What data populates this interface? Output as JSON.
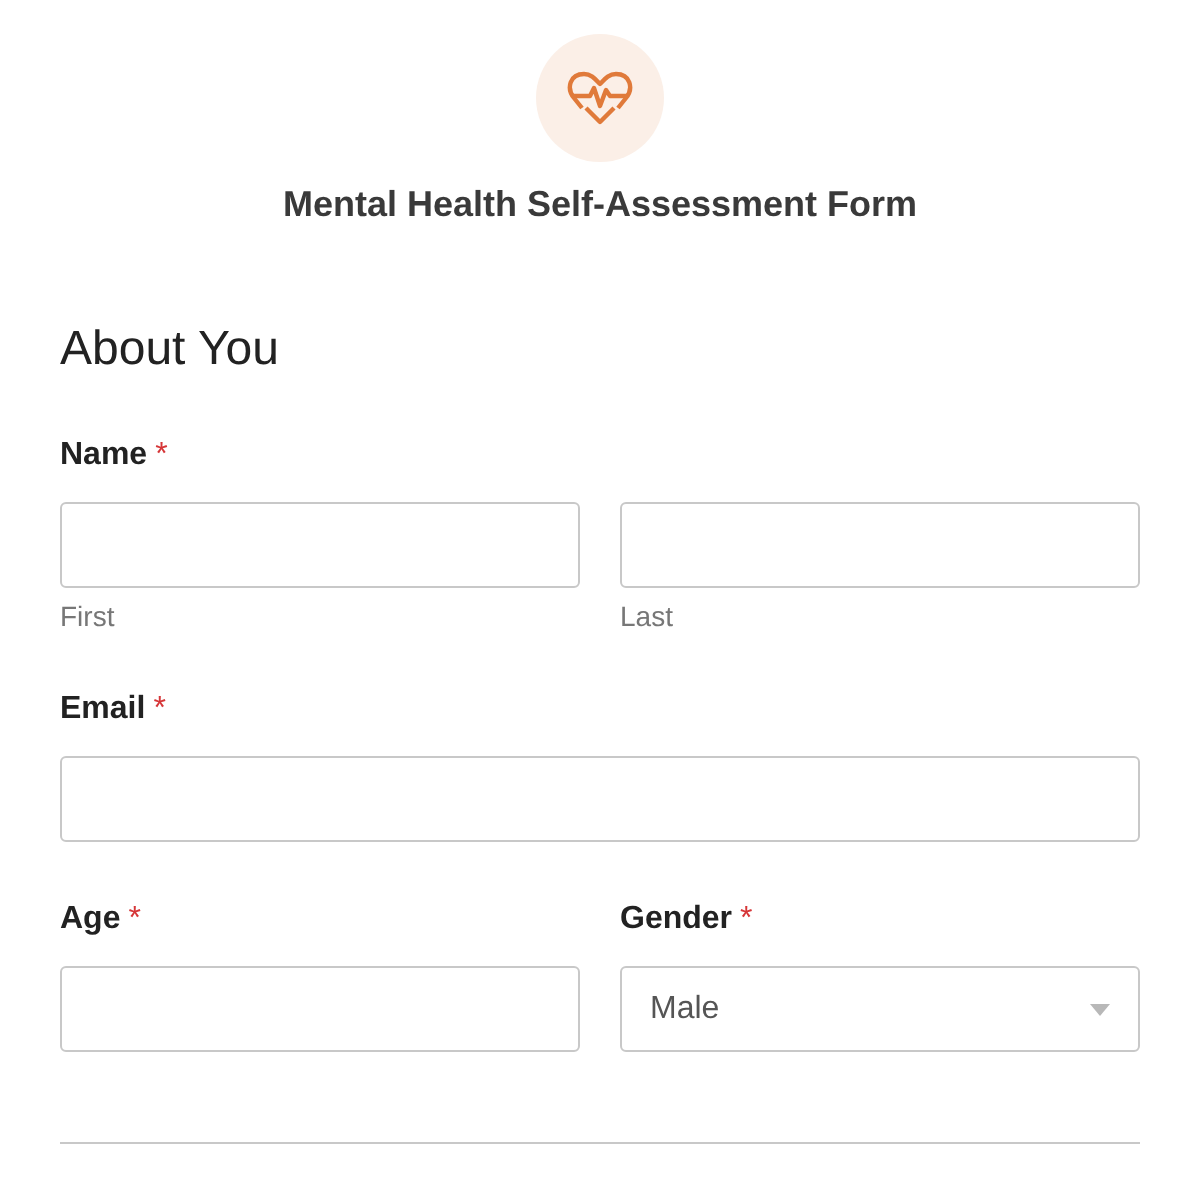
{
  "form": {
    "title": "Mental Health Self-Assessment Form"
  },
  "section": {
    "title": "About You"
  },
  "rows": [
    {
      "groups": [
        {
          "label": "Name",
          "required_mark": "*",
          "inputs": [
            {
              "kind": "text",
              "sublabel": "First"
            },
            {
              "kind": "text",
              "sublabel": "Last"
            }
          ]
        }
      ]
    },
    {
      "groups": [
        {
          "label": "Email",
          "required_mark": "*",
          "inputs": [
            {
              "kind": "text"
            }
          ]
        }
      ]
    },
    {
      "groups": [
        {
          "label": "Age",
          "required_mark": "*",
          "inputs": [
            {
              "kind": "text"
            }
          ]
        },
        {
          "label": "Gender",
          "required_mark": "*",
          "inputs": [
            {
              "kind": "select",
              "value": "Male"
            }
          ]
        }
      ]
    }
  ]
}
